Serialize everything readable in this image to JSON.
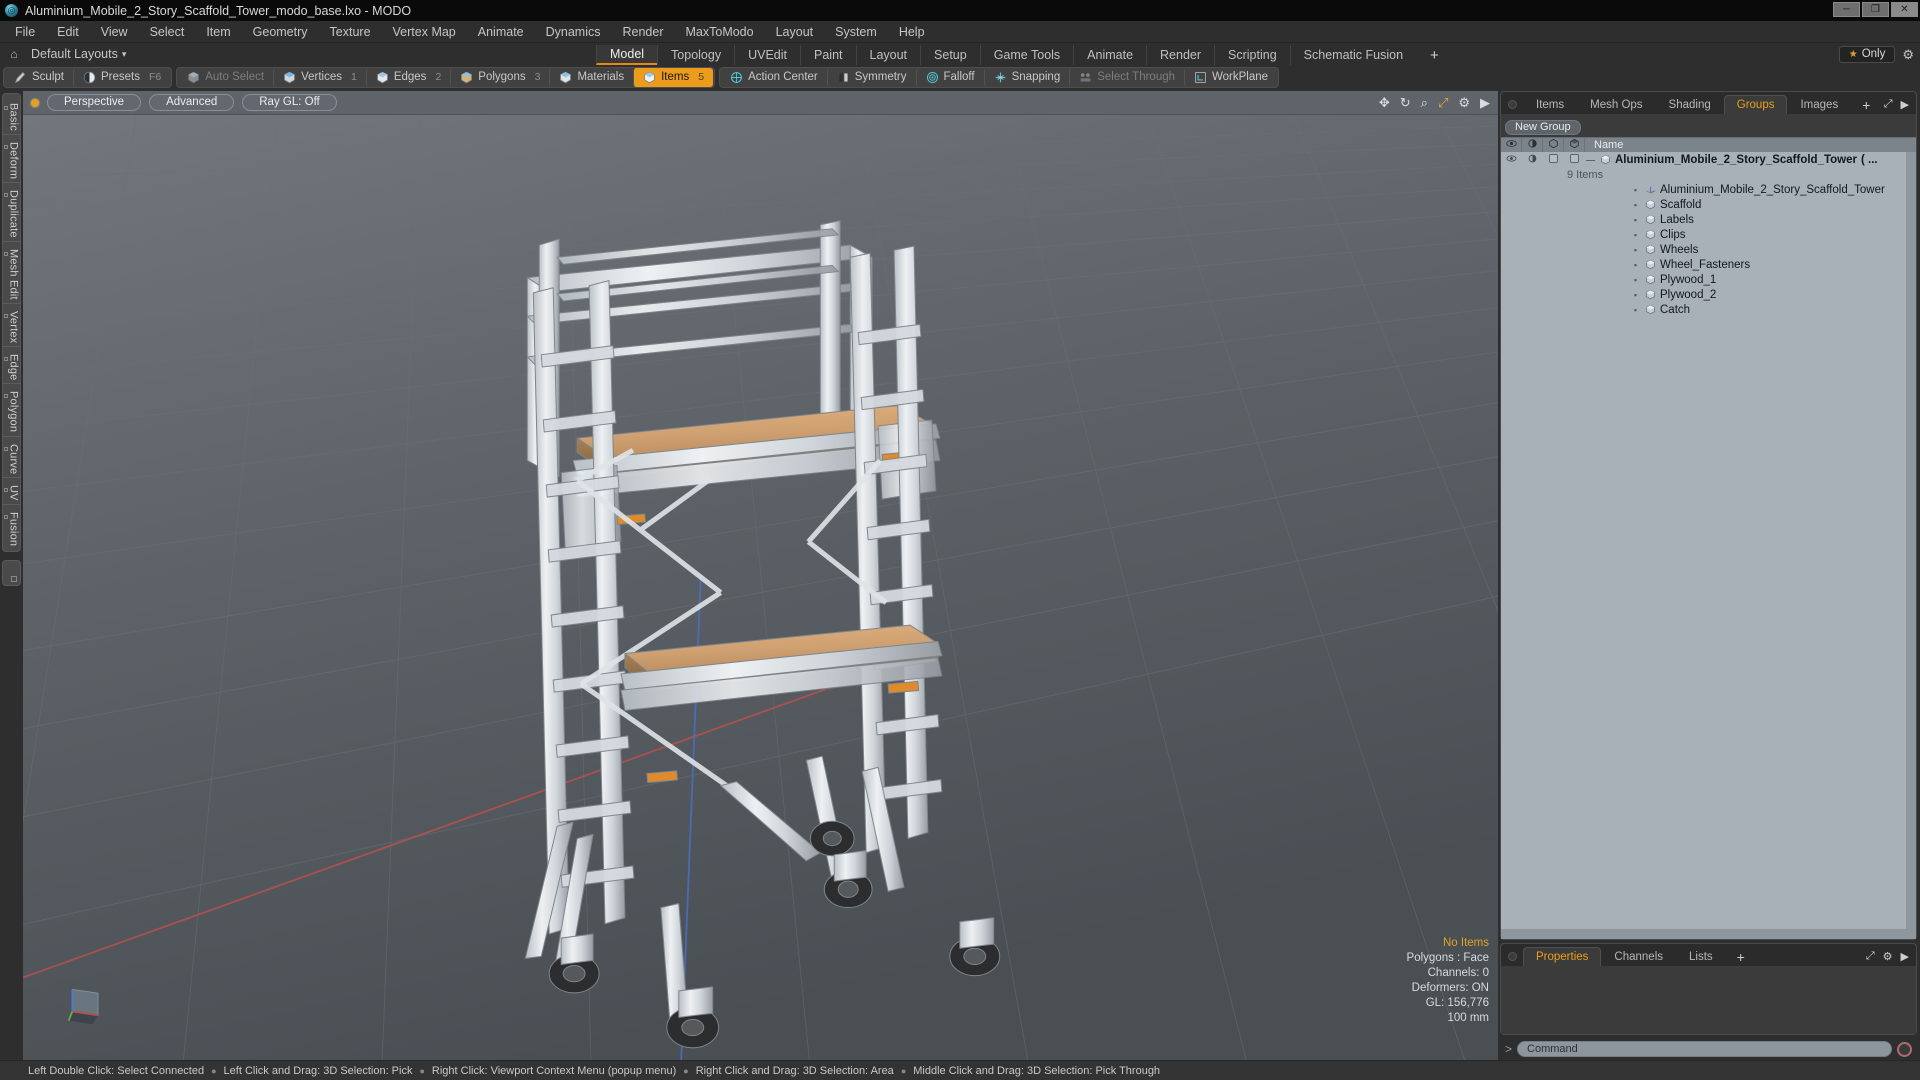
{
  "window": {
    "title": "Aluminium_Mobile_2_Story_Scaffold_Tower_modo_base.lxo - MODO",
    "logo_icon": "modo-logo-icon",
    "minimize": "─",
    "maximize": "❐",
    "close": "✕"
  },
  "menu": {
    "items": [
      {
        "label": "File"
      },
      {
        "label": "Edit"
      },
      {
        "label": "View"
      },
      {
        "label": "Select"
      },
      {
        "label": "Item"
      },
      {
        "label": "Geometry"
      },
      {
        "label": "Texture"
      },
      {
        "label": "Vertex Map"
      },
      {
        "label": "Animate"
      },
      {
        "label": "Dynamics"
      },
      {
        "label": "Render"
      },
      {
        "label": "MaxToModo"
      },
      {
        "label": "Layout"
      },
      {
        "label": "System"
      },
      {
        "label": "Help"
      }
    ]
  },
  "layoutbar": {
    "home_icon": "home-icon",
    "layout_label": "Default Layouts",
    "caret": "▾",
    "tabs": [
      {
        "label": "Model",
        "active": true
      },
      {
        "label": "Topology",
        "active": false
      },
      {
        "label": "UVEdit",
        "active": false
      },
      {
        "label": "Paint",
        "active": false
      },
      {
        "label": "Layout",
        "active": false
      },
      {
        "label": "Setup",
        "active": false
      },
      {
        "label": "Game Tools",
        "active": false
      },
      {
        "label": "Animate",
        "active": false
      },
      {
        "label": "Render",
        "active": false
      },
      {
        "label": "Scripting",
        "active": false
      },
      {
        "label": "Schematic Fusion",
        "active": false
      }
    ],
    "add_tab": "+",
    "only_label": "Only",
    "star_icon": "star-icon",
    "gear_icon": "gear-icon"
  },
  "toolbar": {
    "groups": [
      {
        "buttons": [
          {
            "label": "Sculpt",
            "icon": "sculpt-brush-icon",
            "key": "",
            "state": "normal"
          },
          {
            "label": "Presets",
            "icon": "presets-sphere-icon",
            "key": "F6",
            "state": "normal"
          }
        ]
      },
      {
        "buttons": [
          {
            "label": "Auto Select",
            "icon": "auto-select-cube-icon",
            "key": "",
            "state": "dim"
          },
          {
            "label": "Vertices",
            "icon": "vertices-cube-icon",
            "key": "1",
            "state": "normal"
          },
          {
            "label": "Edges",
            "icon": "edges-cube-icon",
            "key": "2",
            "state": "normal"
          },
          {
            "label": "Polygons",
            "icon": "polygons-cube-icon",
            "key": "3",
            "state": "normal"
          },
          {
            "label": "Materials",
            "icon": "materials-cube-icon",
            "key": "",
            "state": "normal"
          },
          {
            "label": "Items",
            "icon": "items-cube-icon",
            "key": "5",
            "state": "active"
          }
        ]
      },
      {
        "buttons": [
          {
            "label": "Action Center",
            "icon": "action-center-icon",
            "key": "",
            "state": "normal"
          },
          {
            "label": "Symmetry",
            "icon": "symmetry-icon",
            "key": "",
            "state": "normal"
          },
          {
            "label": "Falloff",
            "icon": "falloff-icon",
            "key": "",
            "state": "normal"
          },
          {
            "label": "Snapping",
            "icon": "snapping-icon",
            "key": "",
            "state": "normal"
          },
          {
            "label": "Select Through",
            "icon": "select-through-icon",
            "key": "",
            "state": "dim"
          },
          {
            "label": "WorkPlane",
            "icon": "workplane-icon",
            "key": "",
            "state": "normal"
          }
        ]
      }
    ]
  },
  "leftrail": {
    "tabs": [
      {
        "label": "Basic"
      },
      {
        "label": "Deform"
      },
      {
        "label": "Duplicate"
      },
      {
        "label": "Mesh Edit"
      },
      {
        "label": "Vertex"
      },
      {
        "label": "Edge"
      },
      {
        "label": "Polygon"
      },
      {
        "label": "Curve"
      },
      {
        "label": "UV"
      },
      {
        "label": "Fusion"
      }
    ]
  },
  "viewport": {
    "header": {
      "indicator": "active-viewport-dot",
      "pills": [
        {
          "label": "Perspective"
        },
        {
          "label": "Advanced"
        },
        {
          "label": "Ray GL: Off"
        }
      ],
      "tools": [
        {
          "icon": "move-viewport-icon",
          "glyph": "✥"
        },
        {
          "icon": "rotate-viewport-icon",
          "glyph": "↻"
        },
        {
          "icon": "zoom-viewport-icon",
          "glyph": "⌕"
        },
        {
          "icon": "fit-viewport-icon",
          "glyph": "⤢"
        },
        {
          "icon": "viewport-settings-gear-icon",
          "glyph": "⚙"
        },
        {
          "icon": "viewport-menu-arrow-icon",
          "glyph": "▶"
        }
      ]
    },
    "stats": {
      "selection": "No Items",
      "polygons": "Polygons : Face",
      "channels": "Channels: 0",
      "deformers": "Deformers: ON",
      "gl": "GL: 156,776",
      "grid": "100 mm"
    },
    "axis_gizmo": "axis-gizmo-icon"
  },
  "rightpanel": {
    "tabs": [
      {
        "label": "Items",
        "active": false
      },
      {
        "label": "Mesh Ops",
        "active": false
      },
      {
        "label": "Shading",
        "active": false
      },
      {
        "label": "Groups",
        "active": true
      },
      {
        "label": "Images",
        "active": false
      }
    ],
    "add_tab": "+",
    "expand_icon": "expand-panel-icon",
    "menu_icon": "panel-menu-icon",
    "new_group_button": "New Group",
    "tree_columns": [
      {
        "icon": "visibility-eye-icon",
        "glyph": "◉"
      },
      {
        "icon": "render-visibility-icon",
        "glyph": "◑"
      },
      {
        "icon": "lock-shape-icon",
        "glyph": "⬡"
      },
      {
        "icon": "select-shape-icon",
        "glyph": "⬡"
      }
    ],
    "name_column": "Name",
    "tree": {
      "root": {
        "label": "Aluminium_Mobile_2_Story_Scaffold_Tower",
        "suffix": "( ...",
        "icon": "group-cube-icon",
        "subcount": "9 Items",
        "eye_icon": "visibility-eye-icon",
        "render_icon": "render-visibility-icon"
      },
      "children": [
        {
          "label": "Aluminium_Mobile_2_Story_Scaffold_Tower",
          "icon": "locator-axis-icon"
        },
        {
          "label": "Scaffold",
          "icon": "mesh-cube-icon"
        },
        {
          "label": "Labels",
          "icon": "mesh-cube-icon"
        },
        {
          "label": "Clips",
          "icon": "mesh-cube-icon"
        },
        {
          "label": "Wheels",
          "icon": "mesh-cube-icon"
        },
        {
          "label": "Wheel_Fasteners",
          "icon": "mesh-cube-icon"
        },
        {
          "label": "Plywood_1",
          "icon": "mesh-cube-icon"
        },
        {
          "label": "Plywood_2",
          "icon": "mesh-cube-icon"
        },
        {
          "label": "Catch",
          "icon": "mesh-cube-icon"
        }
      ]
    }
  },
  "bottompanel": {
    "tabs": [
      {
        "label": "Properties",
        "active": true
      },
      {
        "label": "Channels",
        "active": false
      },
      {
        "label": "Lists",
        "active": false
      }
    ],
    "add_tab": "+",
    "expand_icon": "expand-panel-icon",
    "gear_icon": "gear-icon",
    "menu_icon": "panel-menu-icon"
  },
  "commandbar": {
    "prompt": ">",
    "placeholder": "Command",
    "record_icon": "record-command-icon"
  },
  "statusbar": {
    "hints": [
      "Left Double Click: Select Connected",
      "Left Click and Drag: 3D Selection: Pick",
      "Right Click: Viewport Context Menu (popup menu)",
      "Right Click and Drag: 3D Selection: Area",
      "Middle Click and Drag: 3D Selection: Pick Through"
    ],
    "separator": "●"
  },
  "colors": {
    "accent": "#e89f21",
    "panel_bg": "#3b3b3b",
    "tree_bg": "#a8b0b8",
    "viewport_bg": "#5b6166"
  }
}
